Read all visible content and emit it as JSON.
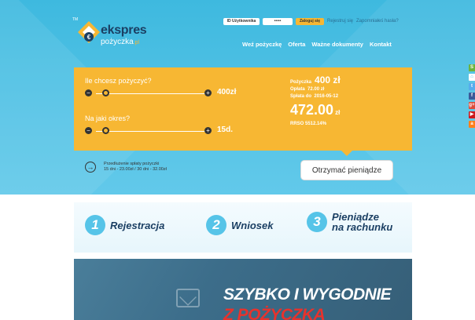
{
  "header": {
    "logo": {
      "trademark": "TM",
      "word_top": "ekspres",
      "word_bottom": "pożyczka",
      "word_bottom_suffix": ".pl"
    },
    "login": {
      "username_placeholder": "ID Użytkownika",
      "password_value": "•••••",
      "login_button": "Zaloguj się",
      "register_link": "Rejestruj się",
      "forgot_link": "Zapomniałeś hasła?"
    },
    "nav": [
      {
        "label": "Weź pożyczkę"
      },
      {
        "label": "Oferta"
      },
      {
        "label": "Ważne dokumenty"
      },
      {
        "label": "Kontakt"
      }
    ]
  },
  "calculator": {
    "amount_question": "Ile chcesz pożyczyć?",
    "amount_value": "400zł",
    "amount_fraction": 0.1,
    "term_question": "Na jaki okres?",
    "term_value": "15d.",
    "term_fraction": 0.1,
    "summary": {
      "loan_label": "Pożyczka",
      "loan_value": "400 zł",
      "fee_label": "Opłata",
      "fee_value": "72.00 zł",
      "due_label": "Spłata do",
      "due_value": "2016-05-12",
      "total_value": "472.00",
      "total_currency": "zł",
      "rrso": "RRSO 5512.14%"
    }
  },
  "extension": {
    "title": "Przedłużenie spłaty pożyczki",
    "details": "15 dni - 23.00zł / 30 dni - 32.00zł"
  },
  "cta": {
    "label": "Otrzymać pieniądze"
  },
  "social": [
    {
      "icon": "skype-icon",
      "color": "#6cb33e",
      "glyph": "S"
    },
    {
      "icon": "home-icon",
      "color": "#ffffff",
      "glyph": "⌂"
    },
    {
      "icon": "twitter-icon",
      "color": "#55acee",
      "glyph": "t"
    },
    {
      "icon": "facebook-icon",
      "color": "#3b5998",
      "glyph": "f"
    },
    {
      "icon": "google-plus-icon",
      "color": "#dd4b39",
      "glyph": "g+"
    },
    {
      "icon": "youtube-icon",
      "color": "#cc181e",
      "glyph": "▶"
    },
    {
      "icon": "allegro-icon",
      "color": "#ff7f1a",
      "glyph": "a"
    }
  ],
  "steps": [
    {
      "number": "1",
      "label": "Rejestracja",
      "label2": ""
    },
    {
      "number": "2",
      "label": "Wniosek",
      "label2": ""
    },
    {
      "number": "3",
      "label": "Pieniądze",
      "label2": "na rachunku"
    }
  ],
  "banner": {
    "line1": "SZYBKO I WYGODNIE",
    "line2": "Z POŻYCZKĄ"
  },
  "colors": {
    "accent_yellow": "#f7b733",
    "hero_blue": "#4fc1e4",
    "navy": "#1b3f63",
    "banner_red": "#e8322c"
  }
}
